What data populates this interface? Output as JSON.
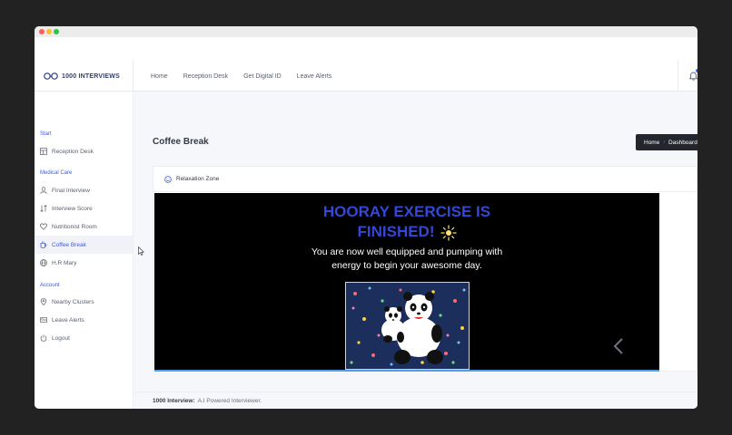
{
  "brand": {
    "name": "1000 INTERVIEWS"
  },
  "nav": {
    "links": [
      "Home",
      "Reception Desk",
      "Get Digital ID",
      "Leave Alerts"
    ]
  },
  "sidebar": {
    "sections": [
      {
        "header": "Start",
        "items": [
          {
            "label": "Reception Desk",
            "icon": "reception-desk-icon"
          }
        ]
      },
      {
        "header": "Medical Care",
        "items": [
          {
            "label": "Final Interview",
            "icon": "user-icon"
          },
          {
            "label": "Interview Score",
            "icon": "sort-icon"
          },
          {
            "label": "Nutritionist Room",
            "icon": "heart-icon"
          },
          {
            "label": "Coffee Break",
            "icon": "coffee-icon",
            "active": true
          },
          {
            "label": "H.R Mary",
            "icon": "globe-icon"
          }
        ]
      },
      {
        "header": "Account",
        "items": [
          {
            "label": "Nearby Clusters",
            "icon": "map-pin-icon"
          },
          {
            "label": "Leave Alerts",
            "icon": "id-card-icon"
          },
          {
            "label": "Logout",
            "icon": "power-icon"
          }
        ]
      }
    ]
  },
  "page": {
    "title": "Coffee Break",
    "breadcrumb": [
      "Home",
      "Dashboard"
    ]
  },
  "card": {
    "title": "Relaxation Zone",
    "slide": {
      "heading_line1": "HOORAY EXERCISE IS",
      "heading_line2": "FINISHED!",
      "text_line1": "You are now well equipped and pumping with",
      "text_line2": "energy to begin your awesome day."
    }
  },
  "footer": {
    "brand": "1000 Interview:",
    "text": "A.I Powered Interviewer."
  },
  "colors": {
    "accent": "#3b5bdb",
    "heading": "#3447d6",
    "breadcrumb_bg": "#23262d",
    "slide_bg": "#000000"
  }
}
